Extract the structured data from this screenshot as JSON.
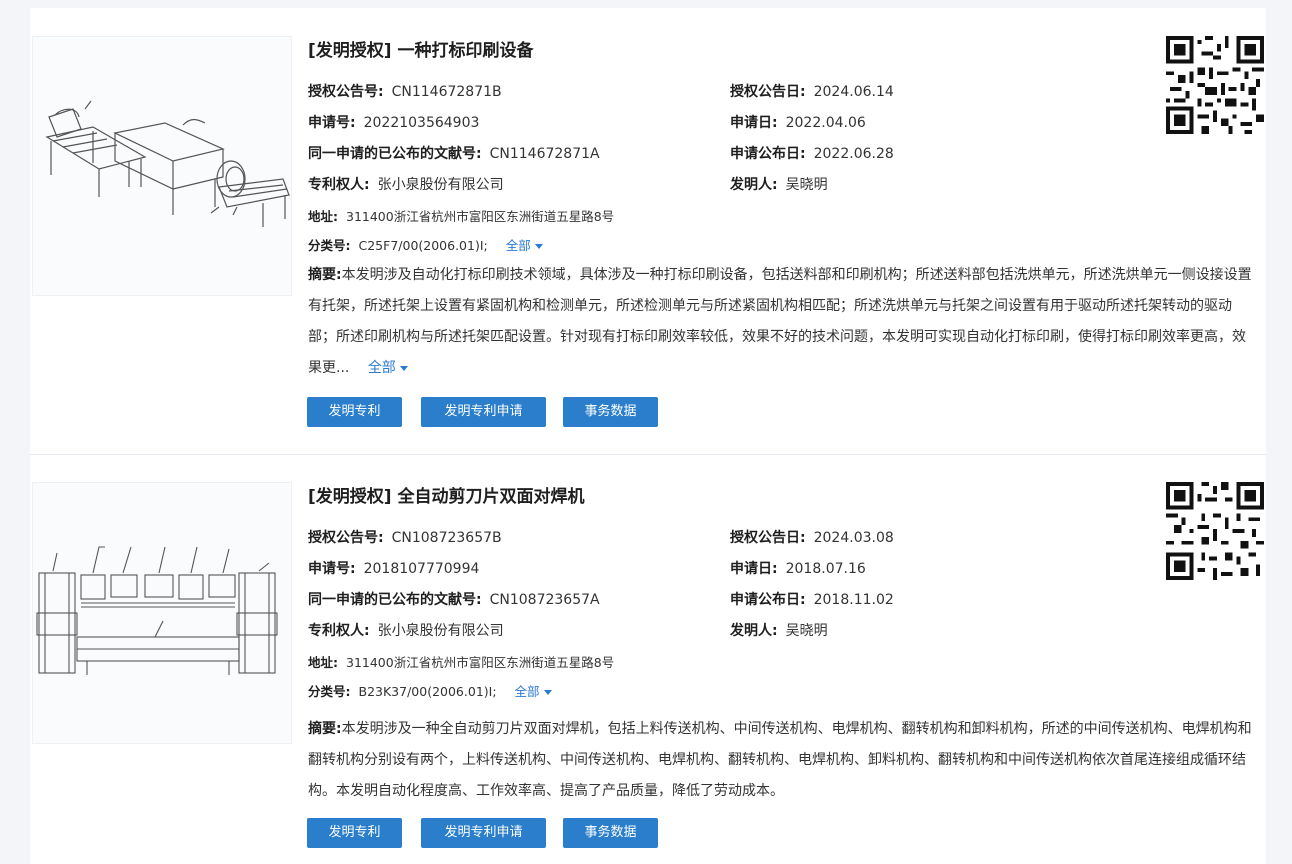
{
  "records": [
    {
      "title": "[发明授权] 一种打标印刷设备",
      "grant_pub_no_label": "授权公告号:",
      "grant_pub_no": "CN114672871B",
      "grant_date_label": "授权公告日:",
      "grant_date": "2024.06.14",
      "app_no_label": "申请号:",
      "app_no": "2022103564903",
      "app_date_label": "申请日:",
      "app_date": "2022.04.06",
      "same_app_label": "同一申请的已公布的文献号:",
      "same_app": "CN114672871A",
      "app_pub_date_label": "申请公布日:",
      "app_pub_date": "2022.06.28",
      "patentee_label": "专利权人:",
      "patentee": "张小泉股份有限公司",
      "inventor_label": "发明人:",
      "inventor": "吴晓明",
      "address_label": "地址:",
      "address": "311400浙江省杭州市富阳区东洲街道五星路8号",
      "class_label": "分类号:",
      "class": "C25F7/00(2006.01)I;",
      "class_more": "全部",
      "abstract_label": "摘要:",
      "abstract": "本发明涉及自动化打标印刷技术领域，具体涉及一种打标印刷设备，包括送料部和印刷机构；所述送料部包括洗烘单元，所述洗烘单元一侧设接设置有托架，所述托架上设置有紧固机构和检测单元，所述检测单元与所述紧固机构相匹配；所述洗烘单元与托架之间设置有用于驱动所述托架转动的驱动部；所述印刷机构与所述托架匹配设置。针对现有打标印刷效率较低，效果不好的技术问题，本发明可实现自动化打标印刷，使得打标印刷效率更高，效果更...",
      "abstract_more": "全部",
      "buttons": [
        "发明专利",
        "发明专利申请",
        "事务数据"
      ]
    },
    {
      "title": "[发明授权] 全自动剪刀片双面对焊机",
      "grant_pub_no_label": "授权公告号:",
      "grant_pub_no": "CN108723657B",
      "grant_date_label": "授权公告日:",
      "grant_date": "2024.03.08",
      "app_no_label": "申请号:",
      "app_no": "2018107770994",
      "app_date_label": "申请日:",
      "app_date": "2018.07.16",
      "same_app_label": "同一申请的已公布的文献号:",
      "same_app": "CN108723657A",
      "app_pub_date_label": "申请公布日:",
      "app_pub_date": "2018.11.02",
      "patentee_label": "专利权人:",
      "patentee": "张小泉股份有限公司",
      "inventor_label": "发明人:",
      "inventor": "吴晓明",
      "address_label": "地址:",
      "address": "311400浙江省杭州市富阳区东洲街道五星路8号",
      "class_label": "分类号:",
      "class": "B23K37/00(2006.01)I;",
      "class_more": "全部",
      "abstract_label": "摘要:",
      "abstract": "本发明涉及一种全自动剪刀片双面对焊机，包括上料传送机构、中间传送机构、电焊机构、翻转机构和卸料机构，所述的中间传送机构、电焊机构和翻转机构分别设有两个，上料传送机构、中间传送机构、电焊机构、翻转机构、电焊机构、卸料机构、翻转机构和中间传送机构依次首尾连接组成循环结构。本发明自动化程度高、工作效率高、提高了产品质量，降低了劳动成本。",
      "buttons": [
        "发明专利",
        "发明专利申请",
        "事务数据"
      ]
    }
  ],
  "colors": {
    "accent": "#2b7ecb",
    "link": "#2a7bd4"
  }
}
